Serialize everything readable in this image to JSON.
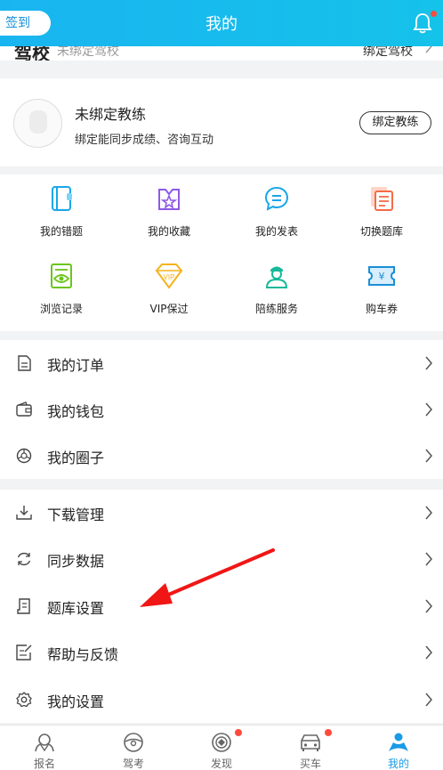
{
  "header": {
    "title": "我的",
    "checkin_label": "签到"
  },
  "school": {
    "title": "驾校",
    "status": "未绑定驾校",
    "bind_label": "绑定驾校"
  },
  "coach": {
    "name": "未绑定教练",
    "description": "绑定能同步成绩、咨询互动",
    "bind_label": "绑定教练"
  },
  "grid": {
    "items": [
      {
        "label": "我的错题",
        "icon": "notebook-icon"
      },
      {
        "label": "我的收藏",
        "icon": "star-bag-icon"
      },
      {
        "label": "我的发表",
        "icon": "chat-bubble-icon"
      },
      {
        "label": "切换题库",
        "icon": "switch-bank-icon"
      },
      {
        "label": "浏览记录",
        "icon": "eye-doc-icon"
      },
      {
        "label": "VIP保过",
        "icon": "vip-diamond-icon"
      },
      {
        "label": "陪练服务",
        "icon": "trainer-icon"
      },
      {
        "label": "购车券",
        "icon": "ticket-icon"
      }
    ]
  },
  "menu1": [
    {
      "label": "我的订单",
      "icon": "order-icon"
    },
    {
      "label": "我的钱包",
      "icon": "wallet-icon"
    },
    {
      "label": "我的圈子",
      "icon": "circle-icon"
    }
  ],
  "menu2": [
    {
      "label": "下载管理",
      "icon": "download-icon"
    },
    {
      "label": "同步数据",
      "icon": "sync-icon"
    },
    {
      "label": "题库设置",
      "icon": "question-bank-icon"
    },
    {
      "label": "帮助与反馈",
      "icon": "feedback-icon"
    },
    {
      "label": "我的设置",
      "icon": "settings-icon"
    }
  ],
  "tabs": [
    {
      "label": "报名",
      "icon": "signup-icon",
      "badge": false,
      "active": false
    },
    {
      "label": "驾考",
      "icon": "steering-wheel-icon",
      "badge": false,
      "active": false
    },
    {
      "label": "发现",
      "icon": "discover-icon",
      "badge": true,
      "active": false
    },
    {
      "label": "买车",
      "icon": "car-icon",
      "badge": true,
      "active": false
    },
    {
      "label": "我的",
      "icon": "profile-icon",
      "badge": false,
      "active": true
    }
  ],
  "colors": {
    "accent": "#1a9be6",
    "header": "#19b5f0",
    "badge": "#ff4b3d",
    "annotation_arrow": "#f01616"
  }
}
